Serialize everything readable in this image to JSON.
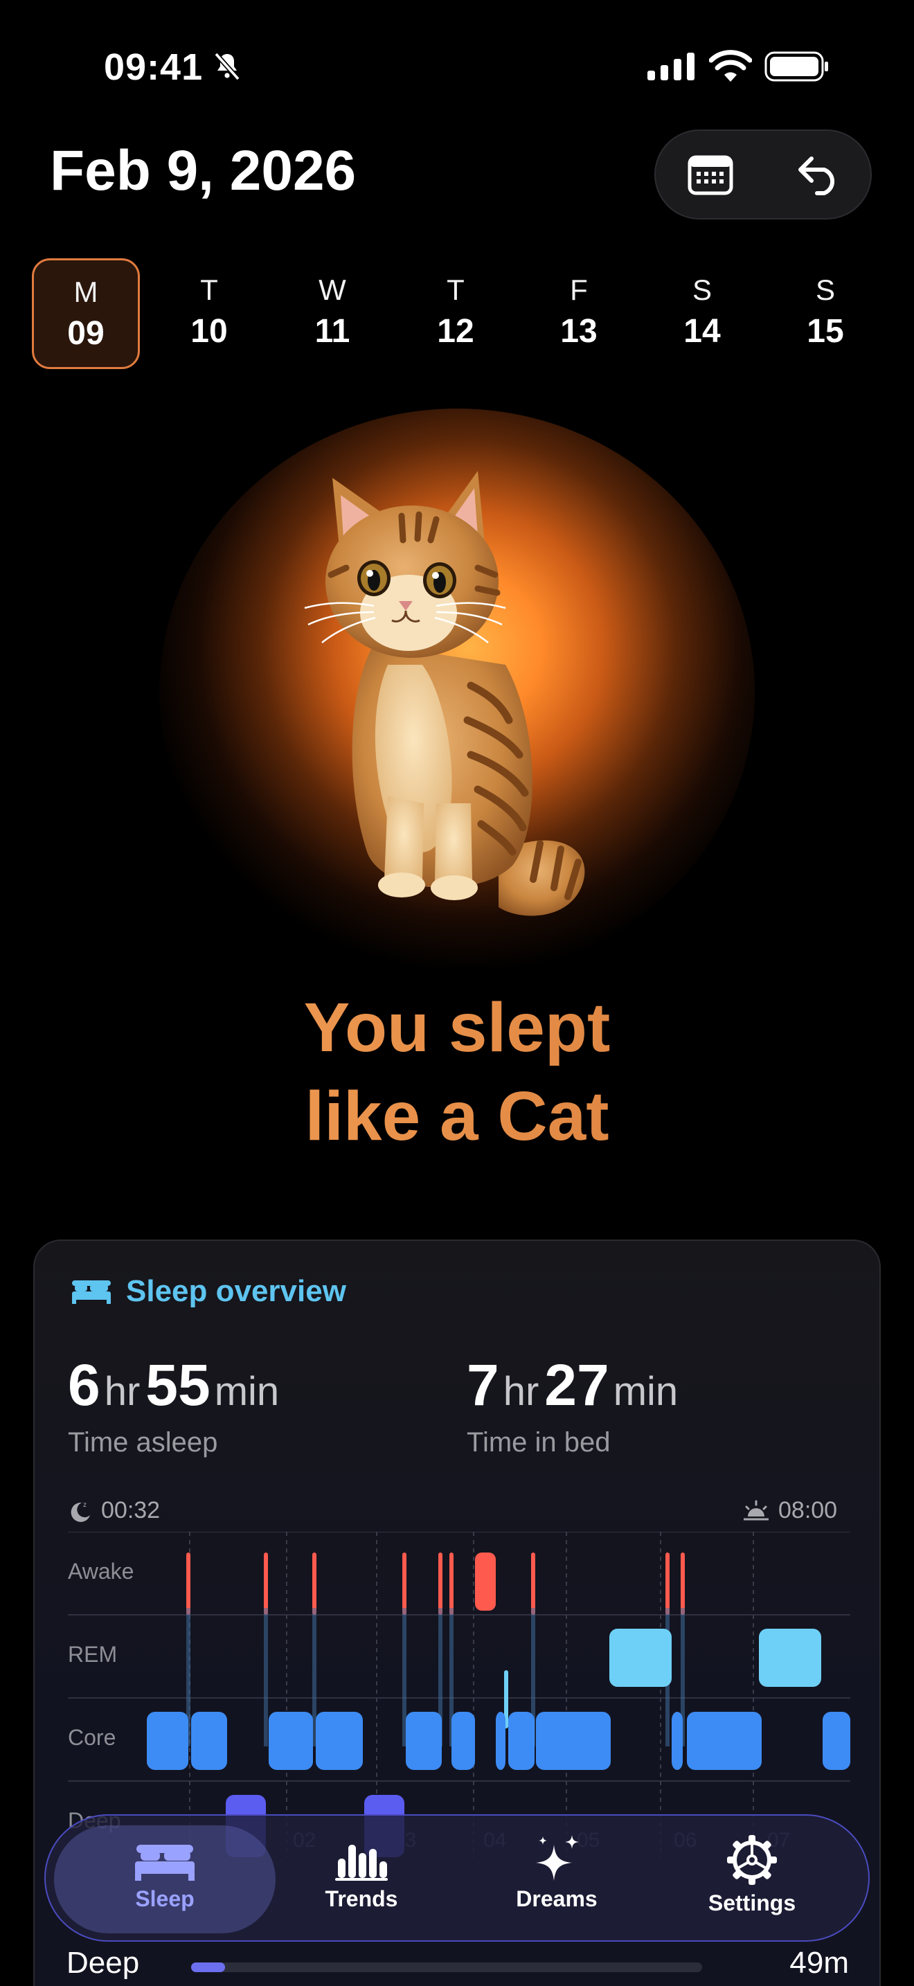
{
  "status": {
    "time": "09:41"
  },
  "header": {
    "date": "Feb 9, 2026",
    "calendar_icon": "calendar-icon",
    "back_icon": "undo-arrow-icon"
  },
  "week": [
    {
      "letter": "M",
      "num": "09",
      "selected": true
    },
    {
      "letter": "T",
      "num": "10",
      "selected": false
    },
    {
      "letter": "W",
      "num": "11",
      "selected": false
    },
    {
      "letter": "T",
      "num": "12",
      "selected": false
    },
    {
      "letter": "F",
      "num": "13",
      "selected": false
    },
    {
      "letter": "S",
      "num": "14",
      "selected": false
    },
    {
      "letter": "S",
      "num": "15",
      "selected": false
    }
  ],
  "hero": {
    "line1": "You slept",
    "line2": "like a Cat"
  },
  "overview": {
    "title": "Sleep overview",
    "asleep": {
      "hr": "6",
      "hr_unit": "hr",
      "min": "55",
      "min_unit": "min",
      "label": "Time asleep"
    },
    "in_bed": {
      "hr": "7",
      "hr_unit": "hr",
      "min": "27",
      "min_unit": "min",
      "label": "Time in bed"
    },
    "start_time": "00:32",
    "end_time": "08:00",
    "stages": [
      "Awake",
      "REM",
      "Core",
      "Deep"
    ],
    "hour_ticks": [
      "02",
      "03",
      "04",
      "05",
      "06",
      "07"
    ]
  },
  "tabs": [
    {
      "label": "Sleep",
      "icon": "bed-icon",
      "active": true
    },
    {
      "label": "Trends",
      "icon": "bar-chart-icon",
      "active": false
    },
    {
      "label": "Dreams",
      "icon": "sparkles-icon",
      "active": false
    },
    {
      "label": "Settings",
      "icon": "gear-icon",
      "active": false
    }
  ],
  "deep_row": {
    "label": "Deep",
    "value": "49m",
    "fraction": 0.066
  },
  "colors": {
    "accent": "#e07b3f",
    "awake": "#ff5a4e",
    "rem": "#6fd0f7",
    "core": "#3d8cf5",
    "deep": "#5b5cf0",
    "tab_active": "#9aa2ff"
  }
}
